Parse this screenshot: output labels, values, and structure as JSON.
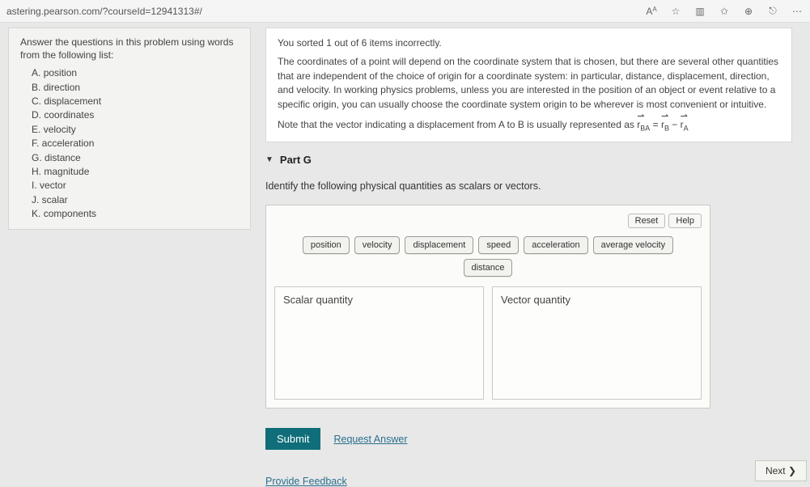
{
  "browser": {
    "url": "astering.pearson.com/?courseId=12941313#/",
    "icons": [
      "AA",
      "star-icon",
      "sidebar-icon",
      "favorite-icon",
      "collections-icon",
      "sync-icon",
      "more-icon"
    ]
  },
  "sidebar": {
    "instruction": "Answer the questions in this problem using words from the following list:",
    "options": [
      {
        "letter": "A",
        "text": "position"
      },
      {
        "letter": "B",
        "text": "direction"
      },
      {
        "letter": "C",
        "text": "displacement"
      },
      {
        "letter": "D",
        "text": "coordinates"
      },
      {
        "letter": "E",
        "text": "velocity"
      },
      {
        "letter": "F",
        "text": "acceleration"
      },
      {
        "letter": "G",
        "text": "distance"
      },
      {
        "letter": "H",
        "text": "magnitude"
      },
      {
        "letter": "I",
        "text": "vector"
      },
      {
        "letter": "J",
        "text": "scalar"
      },
      {
        "letter": "K",
        "text": "components"
      }
    ]
  },
  "feedback": {
    "lead": "You sorted 1 out of 6 items incorrectly.",
    "body": "The coordinates of a point will depend on the coordinate system that is chosen, but there are several other quantities that are independent of the choice of origin for a coordinate system: in particular, distance, displacement, direction, and velocity. In working physics problems, unless you are interested in the position of an object or event relative to a specific origin, you can usually choose the coordinate system origin to be wherever is most convenient or intuitive.",
    "note_pre": "Note that the vector indicating a displacement from A to B is usually represented as ",
    "note_eq": {
      "lhs_sub": "BA",
      "rhs1_sub": "B",
      "rhs2_sub": "A"
    }
  },
  "part": {
    "label": "Part G",
    "prompt": "Identify the following physical quantities as scalars or vectors.",
    "reset": "Reset",
    "help": "Help",
    "chips_row1": [
      "position",
      "velocity",
      "displacement",
      "speed",
      "acceleration",
      "average velocity"
    ],
    "chips_row2": [
      "distance"
    ],
    "bin_a": "Scalar quantity",
    "bin_b": "Vector quantity",
    "submit": "Submit",
    "request_answer": "Request Answer"
  },
  "footer": {
    "provide_feedback": "Provide Feedback",
    "next": "Next ❯"
  }
}
